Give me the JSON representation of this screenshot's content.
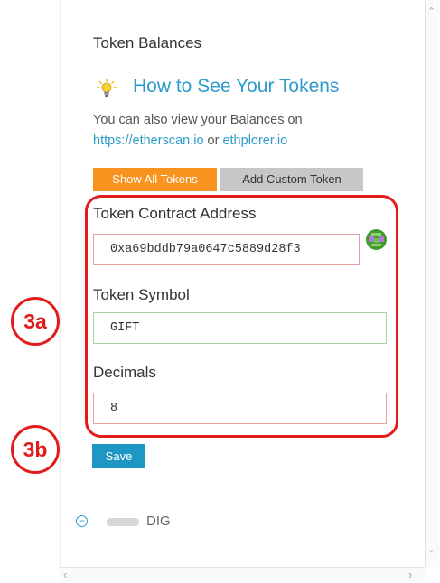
{
  "token_balances": {
    "title": "Token Balances",
    "howto_link": "How to See Your Tokens",
    "para_text": "You can also view your Balances on",
    "etherscan_link": "https://etherscan.io",
    "or_text": " or ",
    "ethplorer_link": "ethplorer.io",
    "show_all_label": "Show All Tokens",
    "add_custom_label": "Add Custom Token"
  },
  "custom_token_form": {
    "contract_address_label": "Token Contract Address",
    "contract_address_value": "0xa69bddb79a0647c5889d28f3",
    "symbol_label": "Token Symbol",
    "symbol_value": "GIFT",
    "decimals_label": "Decimals",
    "decimals_value": "8",
    "save_label": "Save"
  },
  "annotations": {
    "step_a": "3a",
    "step_b": "3b",
    "highlight_color": "#e31b1b"
  },
  "token_list": {
    "item_symbol": "DIG",
    "remove_icon": "minus-circle-icon"
  },
  "colors": {
    "accent_blue": "#2d9ccc",
    "button_orange": "#f7931e",
    "button_gray": "#c7c7c7",
    "save_blue": "#1e97c4"
  }
}
